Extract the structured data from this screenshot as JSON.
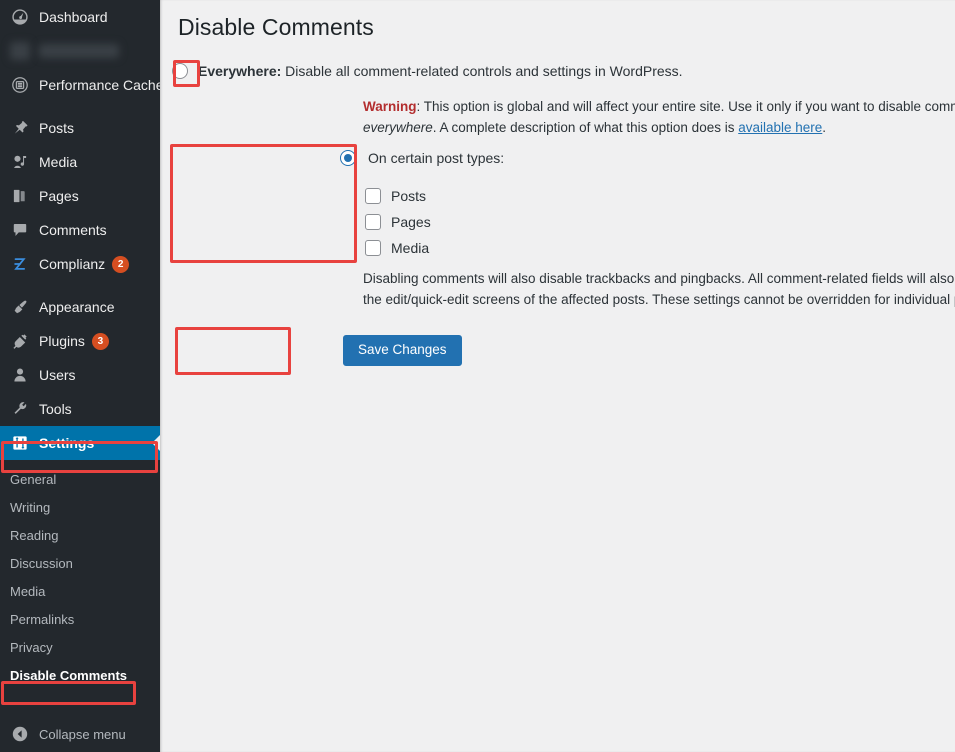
{
  "sidebar": {
    "items": [
      {
        "label": "Dashboard",
        "icon": "dashboard-icon",
        "badge": null,
        "state": "normal"
      },
      {
        "label": "",
        "icon": "redacted-icon",
        "badge": null,
        "state": "redacted"
      },
      {
        "label": "Performance Cache",
        "icon": "performance-cache-icon",
        "badge": null,
        "state": "normal"
      },
      {
        "label": "Posts",
        "icon": "pin-icon",
        "badge": null,
        "state": "normal"
      },
      {
        "label": "Media",
        "icon": "media-icon",
        "badge": null,
        "state": "normal"
      },
      {
        "label": "Pages",
        "icon": "pages-icon",
        "badge": null,
        "state": "normal"
      },
      {
        "label": "Comments",
        "icon": "comment-bubble-icon",
        "badge": null,
        "state": "normal"
      },
      {
        "label": "Complianz",
        "icon": "complianz-z-icon",
        "badge": "2",
        "state": "normal"
      },
      {
        "label": "Appearance",
        "icon": "paintbrush-icon",
        "badge": null,
        "state": "normal"
      },
      {
        "label": "Plugins",
        "icon": "plug-icon",
        "badge": "3",
        "state": "normal"
      },
      {
        "label": "Users",
        "icon": "user-icon",
        "badge": null,
        "state": "normal"
      },
      {
        "label": "Tools",
        "icon": "wrench-icon",
        "badge": null,
        "state": "normal"
      },
      {
        "label": "Settings",
        "icon": "settings-sliders-icon",
        "badge": null,
        "state": "current"
      }
    ],
    "submenu": [
      {
        "label": "General",
        "current": false
      },
      {
        "label": "Writing",
        "current": false
      },
      {
        "label": "Reading",
        "current": false
      },
      {
        "label": "Discussion",
        "current": false
      },
      {
        "label": "Media",
        "current": false
      },
      {
        "label": "Permalinks",
        "current": false
      },
      {
        "label": "Privacy",
        "current": false
      },
      {
        "label": "Disable Comments",
        "current": true
      }
    ],
    "collapse_label": "Collapse menu",
    "collapse_icon": "collapse-arrow-icon"
  },
  "page": {
    "title": "Disable Comments"
  },
  "options": {
    "everywhere": {
      "checked": false,
      "label_strong": "Everywhere:",
      "label_rest": " Disable all comment-related controls and settings in WordPress."
    },
    "warning": {
      "word": "Warning",
      "colon": ":",
      "text_before": " This option is global and will affect your entire site. Use it only if you want to disable comments ",
      "emphasis": "everywhere",
      "text_after": ". A complete description of what this option does is ",
      "link_text": "available here",
      "text_end": "."
    },
    "post_types": {
      "checked": true,
      "label": "On certain post types:",
      "items": [
        {
          "label": "Posts",
          "checked": false
        },
        {
          "label": "Pages",
          "checked": false
        },
        {
          "label": "Media",
          "checked": false
        }
      ]
    },
    "description": "Disabling comments will also disable trackbacks and pingbacks. All comment-related fields will also be hidden from the edit/quick-edit screens of the affected posts. These settings cannot be overridden for individual posts."
  },
  "actions": {
    "save_label": "Save Changes"
  },
  "colors": {
    "sidebar_bg": "#23282d",
    "current_menu_bg": "#0073aa",
    "badge_bg": "#d54e21",
    "button_bg": "#2271b1",
    "link": "#2271b1",
    "warning_red": "#b32d2e",
    "annotation_red": "#e8423f",
    "content_bg": "#f0f0f1"
  },
  "annotations": [
    {
      "name": "annotation-everywhere-radio"
    },
    {
      "name": "annotation-post-types-group"
    },
    {
      "name": "annotation-save-button"
    },
    {
      "name": "annotation-settings-menu"
    },
    {
      "name": "annotation-disable-comments-submenu"
    }
  ]
}
